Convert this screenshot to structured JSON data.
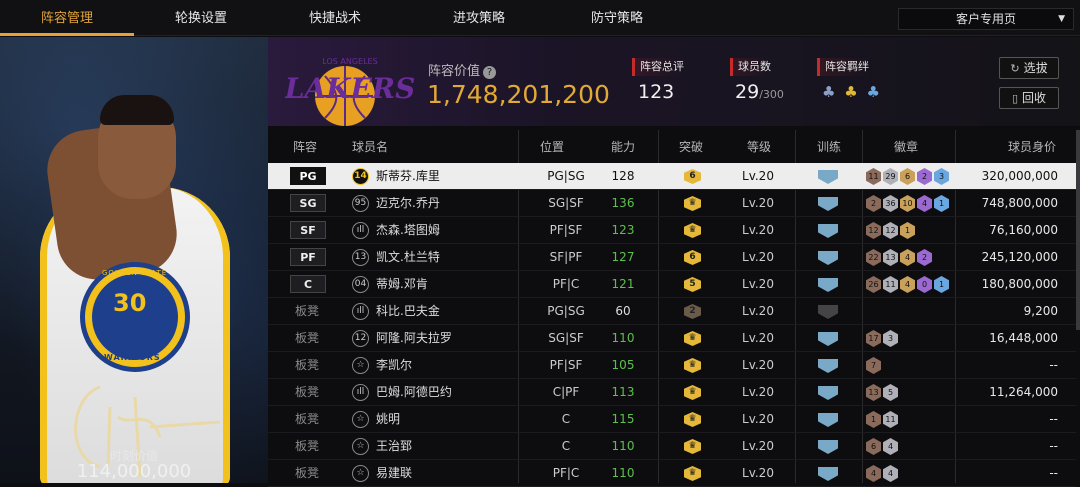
{
  "tabs": [
    "阵容管理",
    "轮换设置",
    "快捷战术",
    "进攻策略",
    "防守策略"
  ],
  "dropdown": {
    "label": "客户专用页"
  },
  "portrait": {
    "jersey_number": "30",
    "team_top": "GOLDEN STATE",
    "team_bottom": "WARRIORS",
    "moment_value_label": "时刻价值",
    "moment_value": "114,000,000"
  },
  "header": {
    "team_value_label": "阵容价值",
    "team_value": "1,748,201,200",
    "overall_label": "阵容总评",
    "overall_value": "123",
    "player_count_label": "球员数",
    "player_count_value": "29",
    "player_count_max": "/300",
    "chemistry_label": "阵容羁绊",
    "chemistry_icons": [
      "group-icon",
      "group-gold-icon",
      "group-blue-icon"
    ],
    "select_button": "选拔",
    "recycle_button": "回收"
  },
  "table": {
    "headers": [
      "阵容",
      "球员名",
      "位置",
      "能力",
      "突破",
      "等级",
      "训练",
      "徽章",
      "球员身价"
    ],
    "rows": [
      {
        "slot": "PG",
        "num": "14",
        "name": "斯蒂芬.库里",
        "pos": "PG|SG",
        "ability": "128",
        "breakthrough": "6",
        "level": "Lv.20",
        "badges": [
          "11",
          "29",
          "6",
          "2",
          "3"
        ],
        "value": "320,000,000"
      },
      {
        "slot": "SG",
        "num": "95",
        "name": "迈克尔.乔丹",
        "pos": "SG|SF",
        "ability": "136",
        "breakthrough": "♛",
        "level": "Lv.20",
        "badges": [
          "2",
          "36",
          "10",
          "4",
          "1"
        ],
        "value": "748,800,000"
      },
      {
        "slot": "SF",
        "num": "ıll",
        "name": "杰森.塔图姆",
        "pos": "PF|SF",
        "ability": "123",
        "breakthrough": "♛",
        "level": "Lv.20",
        "badges": [
          "12",
          "12",
          "1"
        ],
        "value": "76,160,000"
      },
      {
        "slot": "PF",
        "num": "13",
        "name": "凯文.杜兰特",
        "pos": "SF|PF",
        "ability": "127",
        "breakthrough": "6",
        "level": "Lv.20",
        "badges": [
          "22",
          "13",
          "4",
          "2"
        ],
        "value": "245,120,000"
      },
      {
        "slot": "C",
        "num": "04",
        "name": "蒂姆.邓肯",
        "pos": "PF|C",
        "ability": "121",
        "breakthrough": "5",
        "level": "Lv.20",
        "badges": [
          "26",
          "11",
          "4",
          "0",
          "1"
        ],
        "value": "180,800,000"
      },
      {
        "slot": "板凳",
        "num": "ıll",
        "name": "科比.巴夫金",
        "pos": "PG|SG",
        "ability": "60",
        "breakthrough": "2",
        "level": "Lv.20",
        "badges": [],
        "value": "9,200"
      },
      {
        "slot": "板凳",
        "num": "12",
        "name": "阿隆.阿夫拉罗",
        "pos": "SG|SF",
        "ability": "110",
        "breakthrough": "♛",
        "level": "Lv.20",
        "badges": [
          "17",
          "3"
        ],
        "value": "16,448,000"
      },
      {
        "slot": "板凳",
        "num": "☆",
        "name": "李凯尔",
        "pos": "PF|SF",
        "ability": "105",
        "breakthrough": "♛",
        "level": "Lv.20",
        "badges": [
          "7"
        ],
        "value": "--"
      },
      {
        "slot": "板凳",
        "num": "ıll",
        "name": "巴姆.阿德巴约",
        "pos": "C|PF",
        "ability": "113",
        "breakthrough": "♛",
        "level": "Lv.20",
        "badges": [
          "13",
          "5"
        ],
        "value": "11,264,000"
      },
      {
        "slot": "板凳",
        "num": "☆",
        "name": "姚明",
        "pos": "C",
        "ability": "115",
        "breakthrough": "♛",
        "level": "Lv.20",
        "badges": [
          "1",
          "11"
        ],
        "value": "--"
      },
      {
        "slot": "板凳",
        "num": "☆",
        "name": "王治郅",
        "pos": "C",
        "ability": "110",
        "breakthrough": "♛",
        "level": "Lv.20",
        "badges": [
          "6",
          "4"
        ],
        "value": "--"
      },
      {
        "slot": "板凳",
        "num": "☆",
        "name": "易建联",
        "pos": "PF|C",
        "ability": "110",
        "breakthrough": "♛",
        "level": "Lv.20",
        "badges": [
          "4",
          "4"
        ],
        "value": "--"
      }
    ]
  },
  "colors": {
    "accent": "#e0a43a",
    "team_value": "#e1a935",
    "ability_green": "#5cc14a",
    "stat_marker": "#c62b2b"
  }
}
